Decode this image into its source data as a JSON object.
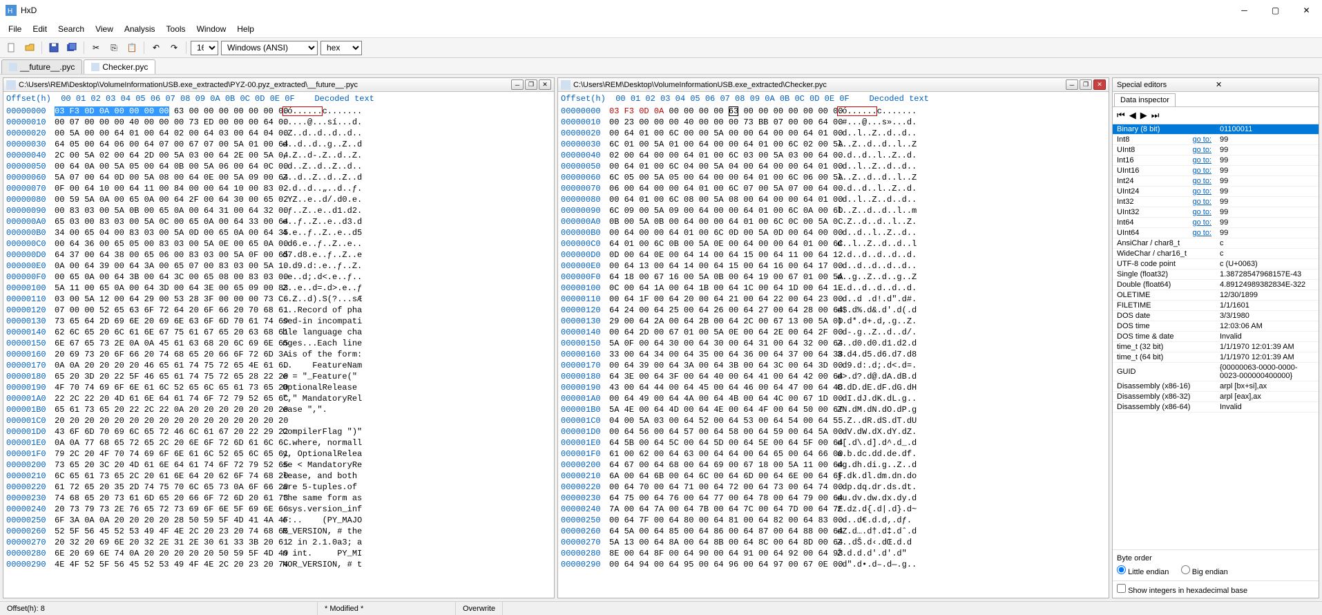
{
  "app": {
    "title": "HxD"
  },
  "menus": [
    "File",
    "Edit",
    "Search",
    "View",
    "Analysis",
    "Tools",
    "Window",
    "Help"
  ],
  "toolbar": {
    "bytes_per_row": "16",
    "encoding": "Windows (ANSI)",
    "base": "hex"
  },
  "tabs": [
    {
      "label": "__future__.pyc",
      "active": false
    },
    {
      "label": "Checker.pyc",
      "active": true
    }
  ],
  "hex_left": {
    "path": "C:\\Users\\REM\\Desktop\\VolumeInformationUSB.exe_extracted\\PYZ-00.pyz_extracted\\__future__.pyc",
    "header": "Offset(h)  00 01 02 03 04 05 06 07 08 09 0A 0B 0C 0D 0E 0F    Decoded text",
    "selection": "03 F3 0D 0A 00 00 00 00",
    "rows": [
      {
        "o": "00000000",
        "h": "03 F3 0D 0A 00 00 00 00 63 00 00 00 00 00 00 00",
        "d": ".ó......c......."
      },
      {
        "o": "00000010",
        "h": "00 07 00 00 00 40 00 00 00 73 ED 00 00 00 64 00",
        "d": ".....@...sí...d."
      },
      {
        "o": "00000020",
        "h": "00 5A 00 00 64 01 00 64 02 00 64 03 00 64 04 00",
        "d": ".Z..d..d..d..d.."
      },
      {
        "o": "00000030",
        "h": "64 05 00 64 06 00 64 07 00 67 07 00 5A 01 00 64",
        "d": "d..d..d..g..Z..d"
      },
      {
        "o": "00000040",
        "h": "2C 00 5A 02 00 64 2D 00 5A 03 00 64 2E 00 5A 04",
        "d": ",.Z..d-.Z..d..Z."
      },
      {
        "o": "00000050",
        "h": "00 64 0A 00 5A 05 00 64 0B 00 5A 06 00 64 0C 00",
        "d": ".d..Z..d..Z..d.."
      },
      {
        "o": "00000060",
        "h": "5A 07 00 64 0D 00 5A 08 00 64 0E 00 5A 09 00 64",
        "d": "Z..d..Z..d..Z..d"
      },
      {
        "o": "00000070",
        "h": "0F 00 64 10 00 64 11 00 84 00 00 64 10 00 83 02",
        "d": "..d..d..„..d..ƒ."
      },
      {
        "o": "00000080",
        "h": "00 59 5A 0A 00 65 0A 00 64 2F 00 64 30 00 65 02",
        "d": ".YZ..e..d/.d0.e."
      },
      {
        "o": "00000090",
        "h": "00 83 03 00 5A 0B 00 65 0A 00 64 31 00 64 32 00",
        "d": ".ƒ..Z..e..d1.d2."
      },
      {
        "o": "000000A0",
        "h": "65 03 00 83 03 00 5A 0C 00 65 0A 00 64 33 00 64",
        "d": "e..ƒ..Z..e..d3.d"
      },
      {
        "o": "000000B0",
        "h": "34 00 65 04 00 83 03 00 5A 0D 00 65 0A 00 64 35",
        "d": "4.e..ƒ..Z..e..d5"
      },
      {
        "o": "000000C0",
        "h": "00 64 36 00 65 05 00 83 03 00 5A 0E 00 65 0A 00",
        "d": ".d6.e..ƒ..Z..e.."
      },
      {
        "o": "000000D0",
        "h": "64 37 00 64 38 00 65 06 00 83 03 00 5A 0F 00 65",
        "d": "d7.d8.e..ƒ..Z..e"
      },
      {
        "o": "000000E0",
        "h": "0A 00 64 39 00 64 3A 00 65 07 00 83 03 00 5A 10",
        "d": "..d9.d:.e..ƒ..Z."
      },
      {
        "o": "000000F0",
        "h": "00 65 0A 00 64 3B 00 64 3C 00 65 08 00 83 03 00",
        "d": ".e..d;.d<.e..ƒ.."
      },
      {
        "o": "00000100",
        "h": "5A 11 00 65 0A 00 64 3D 00 64 3E 00 65 09 00 83",
        "d": "Z..e..d=.d>.e..ƒ"
      },
      {
        "o": "00000110",
        "h": "03 00 5A 12 00 64 29 00 53 28 3F 00 00 00 73 C6",
        "d": "..Z..d).S(?...sÆ"
      },
      {
        "o": "00000120",
        "h": "07 00 00 52 65 63 6F 72 64 20 6F 66 20 70 68 61",
        "d": "...Record of pha"
      },
      {
        "o": "00000130",
        "h": "73 65 64 2D 69 6E 20 69 6E 63 6F 6D 70 61 74 69",
        "d": "sed-in incompati"
      },
      {
        "o": "00000140",
        "h": "62 6C 65 20 6C 61 6E 67 75 61 67 65 20 63 68 61",
        "d": "ble language cha"
      },
      {
        "o": "00000150",
        "h": "6E 67 65 73 2E 0A 0A 45 61 63 68 20 6C 69 6E 65",
        "d": "nges...Each line"
      },
      {
        "o": "00000160",
        "h": "20 69 73 20 6F 66 20 74 68 65 20 66 6F 72 6D 3A",
        "d": " is of the form:"
      },
      {
        "o": "00000170",
        "h": "0A 0A 20 20 20 20 46 65 61 74 75 72 65 4E 61 6D",
        "d": "..    FeatureNam"
      },
      {
        "o": "00000180",
        "h": "65 20 3D 20 22 5F 46 65 61 74 75 72 65 28 22 20",
        "d": "e = \"_Feature(\" "
      },
      {
        "o": "00000190",
        "h": "4F 70 74 69 6F 6E 61 6C 52 65 6C 65 61 73 65 20",
        "d": "OptionalRelease "
      },
      {
        "o": "000001A0",
        "h": "22 2C 22 20 4D 61 6E 64 61 74 6F 72 79 52 65 6C",
        "d": "\",\" MandatoryRel"
      },
      {
        "o": "000001B0",
        "h": "65 61 73 65 20 22 2C 22 0A 20 20 20 20 20 20 20",
        "d": "ease \",\".       "
      },
      {
        "o": "000001C0",
        "h": "20 20 20 20 20 20 20 20 20 20 20 20 20 20 20 20",
        "d": "                "
      },
      {
        "o": "000001D0",
        "h": "43 6F 6D 70 69 6C 65 72 46 6C 61 67 20 22 29 22",
        "d": "CompilerFlag \")\""
      },
      {
        "o": "000001E0",
        "h": "0A 0A 77 68 65 72 65 2C 20 6E 6F 72 6D 61 6C 6C",
        "d": "..where, normall"
      },
      {
        "o": "000001F0",
        "h": "79 2C 20 4F 70 74 69 6F 6E 61 6C 52 65 6C 65 61",
        "d": "y, OptionalRelea"
      },
      {
        "o": "00000200",
        "h": "73 65 20 3C 20 4D 61 6E 64 61 74 6F 72 79 52 65",
        "d": "se < MandatoryRe"
      },
      {
        "o": "00000210",
        "h": "6C 65 61 73 65 2C 20 61 6E 64 20 62 6F 74 68 20",
        "d": "lease, and both "
      },
      {
        "o": "00000220",
        "h": "61 72 65 20 35 2D 74 75 70 6C 65 73 0A 6F 66 20",
        "d": "are 5-tuples.of "
      },
      {
        "o": "00000230",
        "h": "74 68 65 20 73 61 6D 65 20 66 6F 72 6D 20 61 73",
        "d": "the same form as"
      },
      {
        "o": "00000240",
        "h": "20 73 79 73 2E 76 65 72 73 69 6F 6E 5F 69 6E 66",
        "d": " sys.version_inf"
      },
      {
        "o": "00000250",
        "h": "6F 3A 0A 0A 20 20 20 20 28 50 59 5F 4D 41 4A 4F",
        "d": "o:..    (PY_MAJO"
      },
      {
        "o": "00000260",
        "h": "52 5F 56 45 52 53 49 4F 4E 2C 20 23 20 74 68 65",
        "d": "R_VERSION, # the"
      },
      {
        "o": "00000270",
        "h": "20 32 20 69 6E 20 32 2E 31 2E 30 61 33 3B 20 61",
        "d": " 2 in 2.1.0a3; a"
      },
      {
        "o": "00000280",
        "h": "6E 20 69 6E 74 0A 20 20 20 20 20 50 59 5F 4D 49",
        "d": "n int.     PY_MI"
      },
      {
        "o": "00000290",
        "h": "4E 4F 52 5F 56 45 52 53 49 4F 4E 2C 20 23 20 74",
        "d": "NOR_VERSION, # t"
      }
    ]
  },
  "hex_right": {
    "path": "C:\\Users\\REM\\Desktop\\VolumeInformationUSB.exe_extracted\\Checker.pyc",
    "header": "Offset(h)  00 01 02 03 04 05 06 07 08 09 0A 0B 0C 0D 0E 0F    Decoded text",
    "caretcol": 8,
    "rows": [
      {
        "o": "00000000",
        "h": "03 F3 0D 0A 00 00 00 00 63 00 00 00 00 00 00 00",
        "d": ".ó......c......."
      },
      {
        "o": "00000010",
        "h": "00 23 00 00 00 40 00 00 00 73 BB 07 00 00 64 00",
        "d": ".#...@...s»...d."
      },
      {
        "o": "00000020",
        "h": "00 64 01 00 6C 00 00 5A 00 00 64 00 00 64 01 00",
        "d": ".d..l..Z..d..d.."
      },
      {
        "o": "00000030",
        "h": "6C 01 00 5A 01 00 64 00 00 64 01 00 6C 02 00 5A",
        "d": "l..Z..d..d..l..Z"
      },
      {
        "o": "00000040",
        "h": "02 00 64 00 00 64 01 00 6C 03 00 5A 03 00 64 00",
        "d": "..d..d..l..Z..d."
      },
      {
        "o": "00000050",
        "h": "00 64 01 00 6C 04 00 5A 04 00 64 00 00 64 01 00",
        "d": ".d..l..Z..d..d.."
      },
      {
        "o": "00000060",
        "h": "6C 05 00 5A 05 00 64 00 00 64 01 00 6C 06 00 5A",
        "d": "l..Z..d..d..l..Z"
      },
      {
        "o": "00000070",
        "h": "06 00 64 00 00 64 01 00 6C 07 00 5A 07 00 64 00",
        "d": "..d..d..l..Z..d."
      },
      {
        "o": "00000080",
        "h": "00 64 01 00 6C 08 00 5A 08 00 64 00 00 64 01 00",
        "d": ".d..l..Z..d..d.."
      },
      {
        "o": "00000090",
        "h": "6C 09 00 5A 09 00 64 00 00 64 01 00 6C 0A 00 6D",
        "d": "l..Z..d..d..l..m"
      },
      {
        "o": "000000A0",
        "h": "0B 00 5A 0B 00 64 00 00 64 01 00 6C 0C 00 5A 0C",
        "d": "..Z..d..d..l..Z."
      },
      {
        "o": "000000B0",
        "h": "00 64 00 00 64 01 00 6C 0D 00 5A 0D 00 64 00 00",
        "d": ".d..d..l..Z..d.."
      },
      {
        "o": "000000C0",
        "h": "64 01 00 6C 0B 00 5A 0E 00 64 00 00 64 01 00 6C",
        "d": "d..l..Z..d..d..l"
      },
      {
        "o": "000000D0",
        "h": "0D 00 64 0E 00 64 14 00 64 15 00 64 11 00 64 12",
        "d": "..d..d..d..d..d."
      },
      {
        "o": "000000E0",
        "h": "00 64 13 00 64 14 00 64 15 00 64 16 00 64 17 00",
        "d": ".d..d..d..d..d.."
      },
      {
        "o": "000000F0",
        "h": "64 18 00 67 16 00 5A 0B 00 64 19 00 67 01 00 5A",
        "d": "d..g..Z..d..g..Z"
      },
      {
        "o": "00000100",
        "h": "0C 00 64 1A 00 64 1B 00 64 1C 00 64 1D 00 64 1E",
        "d": "..d..d..d..d..d."
      },
      {
        "o": "00000110",
        "h": "00 64 1F 00 64 20 00 64 21 00 64 22 00 64 23 00",
        "d": ".d..d .d!.d\".d#."
      },
      {
        "o": "00000120",
        "h": "64 24 00 64 25 00 64 26 00 64 27 00 64 28 00 64",
        "d": "d$.d%.d&.d'.d(.d"
      },
      {
        "o": "00000130",
        "h": "29 00 64 2A 00 64 2B 00 64 2C 00 67 13 00 5A 0D",
        "d": ").d*.d+.d,.g..Z."
      },
      {
        "o": "00000140",
        "h": "00 64 2D 00 67 01 00 5A 0E 00 64 2E 00 64 2F 00",
        "d": ".d-.g..Z..d..d/."
      },
      {
        "o": "00000150",
        "h": "5A 0F 00 64 30 00 64 30 00 64 31 00 64 32 00 64",
        "d": "Z..d0.d0.d1.d2.d"
      },
      {
        "o": "00000160",
        "h": "33 00 64 34 00 64 35 00 64 36 00 64 37 00 64 38",
        "d": "3.d4.d5.d6.d7.d8"
      },
      {
        "o": "00000170",
        "h": "00 64 39 00 64 3A 00 64 3B 00 64 3C 00 64 3D 00",
        "d": ".d9.d:.d;.d<.d=."
      },
      {
        "o": "00000180",
        "h": "64 3E 00 64 3F 00 64 40 00 64 41 00 64 42 00 64",
        "d": "d>.d?.d@.dA.dB.d"
      },
      {
        "o": "00000190",
        "h": "43 00 64 44 00 64 45 00 64 46 00 64 47 00 64 48",
        "d": "C.dD.dE.dF.dG.dH"
      },
      {
        "o": "000001A0",
        "h": "00 64 49 00 64 4A 00 64 4B 00 64 4C 00 67 1D 00",
        "d": ".dI.dJ.dK.dL.g.."
      },
      {
        "o": "000001B0",
        "h": "5A 4E 00 64 4D 00 64 4E 00 64 4F 00 64 50 00 67",
        "d": "ZN.dM.dN.dO.dP.g"
      },
      {
        "o": "000001C0",
        "h": "04 00 5A 03 00 64 52 00 64 53 00 64 54 00 64 55",
        "d": "..Z..dR.dS.dT.dU"
      },
      {
        "o": "000001D0",
        "h": "00 64 56 00 64 57 00 64 58 00 64 59 00 64 5A 00",
        "d": ".dV.dW.dX.dY.dZ."
      },
      {
        "o": "000001E0",
        "h": "64 5B 00 64 5C 00 64 5D 00 64 5E 00 64 5F 00 64",
        "d": "d[.d\\.d].d^.d_.d"
      },
      {
        "o": "000001F0",
        "h": "61 00 62 00 64 63 00 64 64 00 64 65 00 64 66 00",
        "d": "a.b.dc.dd.de.df."
      },
      {
        "o": "00000200",
        "h": "64 67 00 64 68 00 64 69 00 67 18 00 5A 11 00 64",
        "d": "dg.dh.di.g..Z..d"
      },
      {
        "o": "00000210",
        "h": "6A 00 64 6B 00 64 6C 00 64 6D 00 64 6E 00 64 6F",
        "d": "j.dk.dl.dm.dn.do"
      },
      {
        "o": "00000220",
        "h": "00 64 70 00 64 71 00 64 72 00 64 73 00 64 74 00",
        "d": ".dp.dq.dr.ds.dt."
      },
      {
        "o": "00000230",
        "h": "64 75 00 64 76 00 64 77 00 64 78 00 64 79 00 64",
        "d": "du.dv.dw.dx.dy.d"
      },
      {
        "o": "00000240",
        "h": "7A 00 64 7A 00 64 7B 00 64 7C 00 64 7D 00 64 7E",
        "d": "z.dz.d{.d|.d}.d~"
      },
      {
        "o": "00000250",
        "h": "00 64 7F 00 64 80 00 64 81 00 64 82 00 64 83 00",
        "d": ".d..d€.d.d‚.dƒ."
      },
      {
        "o": "00000260",
        "h": "64 5A 00 64 85 00 64 86 00 64 87 00 64 88 00 64",
        "d": "dZ.d….d†.d‡.dˆ.d"
      },
      {
        "o": "00000270",
        "h": "5A 13 00 64 8A 00 64 8B 00 64 8C 00 64 8D 00 64",
        "d": "Z..dŠ.d‹.dŒ.d.d"
      },
      {
        "o": "00000280",
        "h": "8E 00 64 8F 00 64 90 00 64 91 00 64 92 00 64 93",
        "d": "Ž.d.d.d'.d'.d\""
      },
      {
        "o": "00000290",
        "h": "00 64 94 00 64 95 00 64 96 00 64 97 00 67 0E 00",
        "d": ".d\".d•.d–.d—.g.."
      }
    ]
  },
  "special_editors": {
    "title": "Special editors",
    "tab": "Data inspector"
  },
  "inspector": [
    {
      "k": "Binary (8 bit)",
      "v": "01100011",
      "hl": true
    },
    {
      "k": "Int8",
      "v": "99",
      "goto": true
    },
    {
      "k": "UInt8",
      "v": "99",
      "goto": true
    },
    {
      "k": "Int16",
      "v": "99",
      "goto": true
    },
    {
      "k": "UInt16",
      "v": "99",
      "goto": true
    },
    {
      "k": "Int24",
      "v": "99",
      "goto": true
    },
    {
      "k": "UInt24",
      "v": "99",
      "goto": true
    },
    {
      "k": "Int32",
      "v": "99",
      "goto": true
    },
    {
      "k": "UInt32",
      "v": "99",
      "goto": true
    },
    {
      "k": "Int64",
      "v": "99",
      "goto": true
    },
    {
      "k": "UInt64",
      "v": "99",
      "goto": true
    },
    {
      "k": "AnsiChar / char8_t",
      "v": "c"
    },
    {
      "k": "WideChar / char16_t",
      "v": "c"
    },
    {
      "k": "UTF-8 code point",
      "v": "c (U+0063)"
    },
    {
      "k": "Single (float32)",
      "v": "1.38728547968157E-43"
    },
    {
      "k": "Double (float64)",
      "v": "4.89124989382834E-322"
    },
    {
      "k": "OLETIME",
      "v": "12/30/1899"
    },
    {
      "k": "FILETIME",
      "v": "1/1/1601"
    },
    {
      "k": "DOS date",
      "v": "3/3/1980"
    },
    {
      "k": "DOS time",
      "v": "12:03:06 AM"
    },
    {
      "k": "DOS time & date",
      "v": "Invalid"
    },
    {
      "k": "time_t (32 bit)",
      "v": "1/1/1970 12:01:39 AM"
    },
    {
      "k": "time_t (64 bit)",
      "v": "1/1/1970 12:01:39 AM"
    },
    {
      "k": "GUID",
      "v": "{00000063-0000-0000-0023-000000400000}"
    },
    {
      "k": "Disassembly (x86-16)",
      "v": "arpl [bx+si],ax"
    },
    {
      "k": "Disassembly (x86-32)",
      "v": "arpl [eax],ax"
    },
    {
      "k": "Disassembly (x86-64)",
      "v": "Invalid"
    }
  ],
  "byteorder": {
    "label": "Byte order",
    "le": "Little endian",
    "be": "Big endian"
  },
  "show_hex_check": "Show integers in hexadecimal base",
  "goto_label": "go to:",
  "status": {
    "offset": "Offset(h): 8",
    "modified": "* Modified *",
    "mode": "Overwrite"
  }
}
